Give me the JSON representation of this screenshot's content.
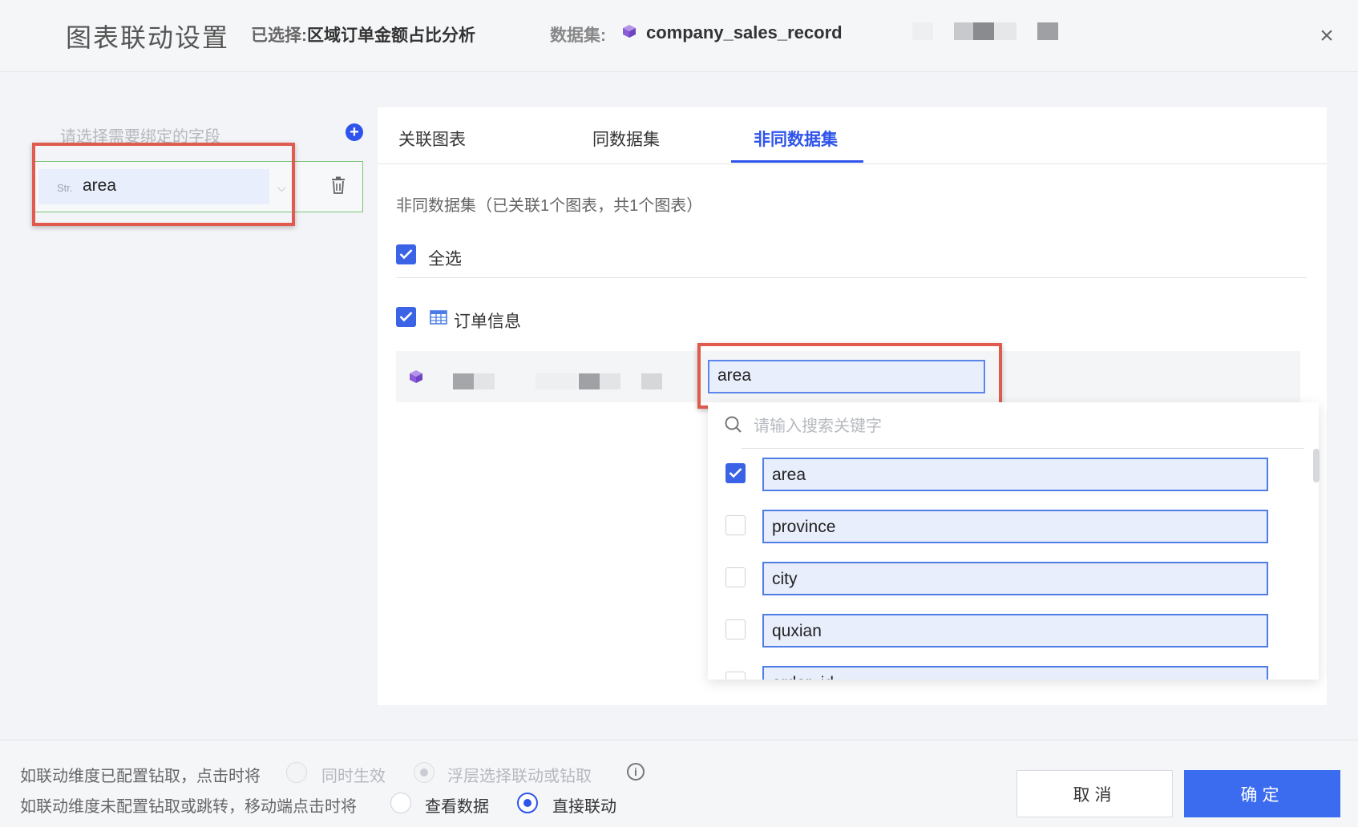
{
  "header": {
    "title": "图表联动设置",
    "selected_prefix": "已选择:",
    "selected_chart": "区域订单金额占比分析",
    "dataset_label": "数据集:",
    "dataset_name": "company_sales_record",
    "close_glyph": "×"
  },
  "left_panel": {
    "placeholder": "请选择需要绑定的字段",
    "add_glyph": "+",
    "field": {
      "type_tag": "Str.",
      "value": "area",
      "chevron": "⌵"
    }
  },
  "tabs": [
    {
      "label": "关联图表",
      "active": false
    },
    {
      "label": "同数据集",
      "active": false
    },
    {
      "label": "非同数据集",
      "active": true
    }
  ],
  "main": {
    "summary": "非同数据集（已关联1个图表，共1个图表）",
    "select_all": {
      "label": "全选",
      "checked": true
    },
    "table": {
      "label": "订单信息",
      "checked": true
    },
    "mapping": {
      "selected_field": "area"
    }
  },
  "dropdown": {
    "search_placeholder": "请输入搜索关键字",
    "options": [
      {
        "label": "area",
        "checked": true
      },
      {
        "label": "province",
        "checked": false
      },
      {
        "label": "city",
        "checked": false
      },
      {
        "label": "quxian",
        "checked": false
      },
      {
        "label": "order_id",
        "checked": false
      }
    ]
  },
  "footer": {
    "drill_rule_label": "如联动维度已配置钻取，点击时将",
    "drill_option_1": "同时生效",
    "drill_option_2": "浮层选择联动或钻取",
    "info_glyph": "i",
    "mobile_rule_label": "如联动维度未配置钻取或跳转，移动端点击时将",
    "mobile_option_1": "查看数据",
    "mobile_option_2": "直接联动",
    "cancel_label": "取消",
    "confirm_label": "确定"
  },
  "colors": {
    "accent": "#2f54eb",
    "highlight_box": "#e05a4e",
    "field_row_border": "#7cc47c",
    "cube_icon": "#8a5cd6"
  }
}
